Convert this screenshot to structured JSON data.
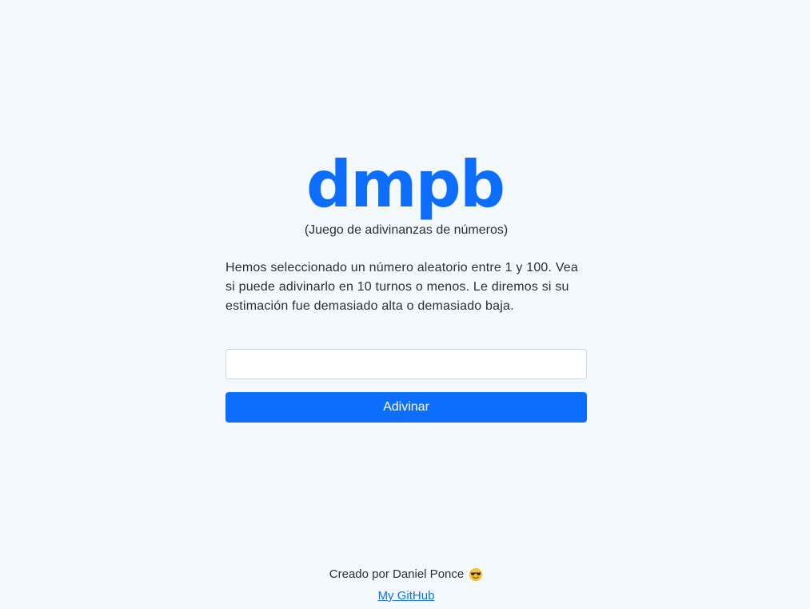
{
  "app": {
    "logo": "dmpb",
    "subtitle": "(Juego de adivinanzas de números)"
  },
  "game": {
    "description": "Hemos seleccionado un número aleatorio entre 1 y 100. Vea si puede adivinarlo en 10 turnos o menos. Le diremos si su estimación fue demasiado alta o demasiado baja.",
    "input_value": "",
    "input_placeholder": "",
    "button_label": "Adivinar"
  },
  "footer": {
    "credit": "Creado por Daniel Ponce",
    "emoji_icon": "sunglasses-face-icon",
    "link_label": "My GitHub"
  },
  "colors": {
    "accent": "#0d6efd",
    "background": "#f3f9fd",
    "text": "#2a2f36"
  }
}
